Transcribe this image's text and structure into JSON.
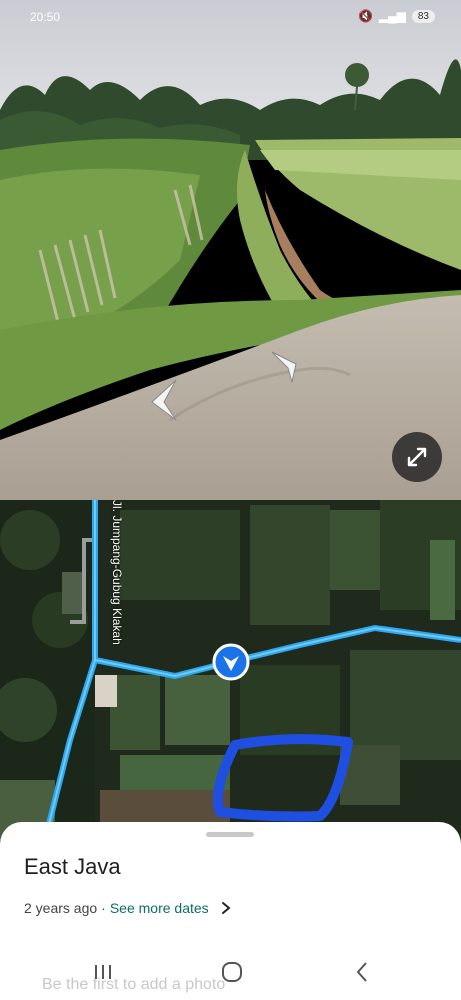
{
  "status": {
    "time": "20:50",
    "battery": "83"
  },
  "map": {
    "road_label": "Jl. Jumpang-Gubug Klakah"
  },
  "sheet": {
    "place": "East Java",
    "age": "2 years ago",
    "separator": "·",
    "see_more": "See more dates",
    "add_photo": "Be the first to add a photo"
  },
  "icons": {
    "forward": "chevron-forward-icon",
    "back": "chevron-back-icon",
    "expand": "expand-icon",
    "pegman": "direction-marker-icon",
    "recents": "recents-icon",
    "home": "home-icon",
    "back_nav": "back-icon"
  },
  "colors": {
    "route": "#2aa9f0",
    "marker": "#1a73e8",
    "annotation": "#1f4fe0",
    "link": "#0b6f63"
  }
}
